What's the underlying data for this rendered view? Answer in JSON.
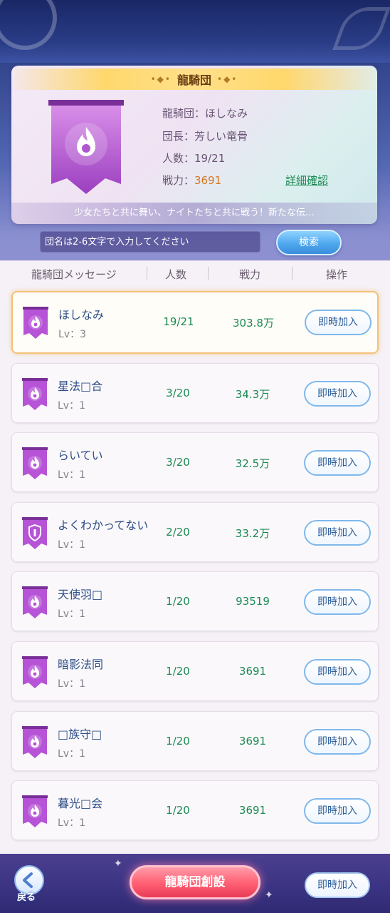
{
  "header": {
    "title": "龍騎団",
    "info": {
      "guild_label": "龍騎団：ほしなみ",
      "leader_label": "団長：芳しい竜骨",
      "members_prefix": "人数：",
      "members_value": "19/21",
      "power_prefix": "戦力：",
      "power_value": "3691"
    },
    "detail_link": "詳細確認",
    "motto": "少女たちと共に舞い、ナイトたちと共に戦う！新たな伝…"
  },
  "search": {
    "placeholder": "団名は2-6文字で入力してください",
    "button": "検索"
  },
  "table": {
    "columns": [
      "龍騎団メッセージ",
      "人数",
      "戦力",
      "操作"
    ],
    "rows": [
      {
        "name": "ほしなみ",
        "lv": "Lv：3",
        "count": "19/21",
        "power": "303.8万",
        "action": "即時加入",
        "icon": "flame-emblem-icon"
      },
      {
        "name": "星法□合",
        "lv": "Lv：1",
        "count": "3/20",
        "power": "34.3万",
        "action": "即時加入",
        "icon": "flame-emblem-icon"
      },
      {
        "name": "らいてい",
        "lv": "Lv：1",
        "count": "3/20",
        "power": "32.5万",
        "action": "即時加入",
        "icon": "flame-emblem-icon"
      },
      {
        "name": "よくわかってない",
        "lv": "Lv：1",
        "count": "2/20",
        "power": "33.2万",
        "action": "即時加入",
        "icon": "shield-emblem-icon"
      },
      {
        "name": "天使羽□",
        "lv": "Lv：1",
        "count": "1/20",
        "power": "93519",
        "action": "即時加入",
        "icon": "flame-emblem-icon"
      },
      {
        "name": "暗影法同",
        "lv": "Lv：1",
        "count": "1/20",
        "power": "3691",
        "action": "即時加入",
        "icon": "flame-emblem-icon"
      },
      {
        "name": "□族守□",
        "lv": "Lv：1",
        "count": "1/20",
        "power": "3691",
        "action": "即時加入",
        "icon": "flame-emblem-icon"
      },
      {
        "name": "暮光□会",
        "lv": "Lv：1",
        "count": "1/20",
        "power": "3691",
        "action": "即時加入",
        "icon": "flame-emblem-icon"
      }
    ]
  },
  "bottom": {
    "back_label": "戻る",
    "create_button": "龍騎団創設",
    "join_button": "即時加入"
  },
  "colors": {
    "accent_green": "#1b8a52",
    "accent_orange": "#d2781f",
    "banner_purple": "#b14fcf",
    "create_red": "#ff5e72"
  }
}
